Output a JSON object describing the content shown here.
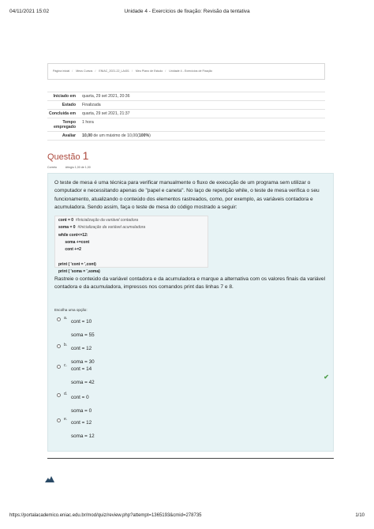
{
  "print_header": {
    "date": "04/11/2021 15:02",
    "title": "Unidade 4 - Exercícios de fixação: Revisão da tentativa"
  },
  "print_footer": {
    "url": "https://portalacademico.eniac.edu.br/mod/quiz/review.php?attempt=1365193&cmid=278735",
    "page": "1/10"
  },
  "breadcrumb": [
    "Página inicial",
    "Meus Cursos",
    "ENIAC_2021-22_LA401",
    "Meu Plano de Estudo",
    "Unidade 4 - Exercícios de Fixação"
  ],
  "summary": [
    {
      "key": "Iniciado em",
      "value": "quarta, 29 set 2021, 20:36"
    },
    {
      "key": "Estado",
      "value": "Finalizada"
    },
    {
      "key": "Concluída em",
      "value": "quarta, 29 set 2021, 21:37"
    },
    {
      "key": "Tempo empregado",
      "value": "1 hora"
    },
    {
      "key": "Avaliar",
      "value_bold": "10,00",
      "value_rest": " de um máximo de 10,00(",
      "value_pct": "100%",
      "value_end": ")"
    }
  ],
  "question": {
    "label": "Questão",
    "number": "1",
    "status": "Correto",
    "grade": "Atingiu 1,00 de 1,00",
    "text": "O teste de mesa é uma técnica para verificar manualmente o fluxo de execução de um programa sem utilizar o computador e necessitando apenas de \"papel e caneta\". No laço de repetição while, o teste de mesa verifica o seu funcionamento, atualizando o conteúdo dos elementos rastreados, como, por exemplo, as variáveis contadora e acumuladora. Sendo assim, faça o teste de mesa do código mostrado a seguir:",
    "code": [
      {
        "code": "cont = 0",
        "comment": "  #Inicialização da variável contadora"
      },
      {
        "code": "soma = 0",
        "comment": "  #Inicialização da variável acumuladora"
      },
      {
        "code": "while cont<=12:",
        "comment": ""
      },
      {
        "code": "      soma +=cont",
        "comment": ""
      },
      {
        "code": "      cont +=2",
        "comment": ""
      },
      {
        "code": "",
        "comment": ""
      },
      {
        "code": "print ( 'cont = ',cont)",
        "comment": ""
      },
      {
        "code": "print ( 'soma = ',soma)",
        "comment": ""
      }
    ],
    "text2": "Rastreie o conteúdo da variável contadora e da acumuladora e marque a alternativa com os valores finais da variável contadora e da acumuladora, impressos nos comandos print das linhas 7 e 8.",
    "choose_label": "Escolha uma opção:",
    "options": [
      {
        "letter": "a.",
        "line1": "cont = 10",
        "line2": "soma = 55",
        "correct": false
      },
      {
        "letter": "b.",
        "line1": "cont = 12",
        "line2": "soma = 30",
        "correct": false
      },
      {
        "letter": "c.",
        "line1": "cont = 14",
        "line2": "soma = 42",
        "correct": true
      },
      {
        "letter": "d.",
        "line1": "cont = 0",
        "line2": "soma = 0",
        "correct": false
      },
      {
        "letter": "e.",
        "line1": "cont = 12",
        "line2": "soma = 12",
        "correct": false
      }
    ]
  },
  "colors": {
    "question_title": "#ad4b3f",
    "question_bg": "#e7f3f5",
    "check": "#4f9e4a",
    "logo": "#2a4a66"
  },
  "icons": {
    "correct": "check-icon",
    "logo": "mountain-logo-icon"
  }
}
